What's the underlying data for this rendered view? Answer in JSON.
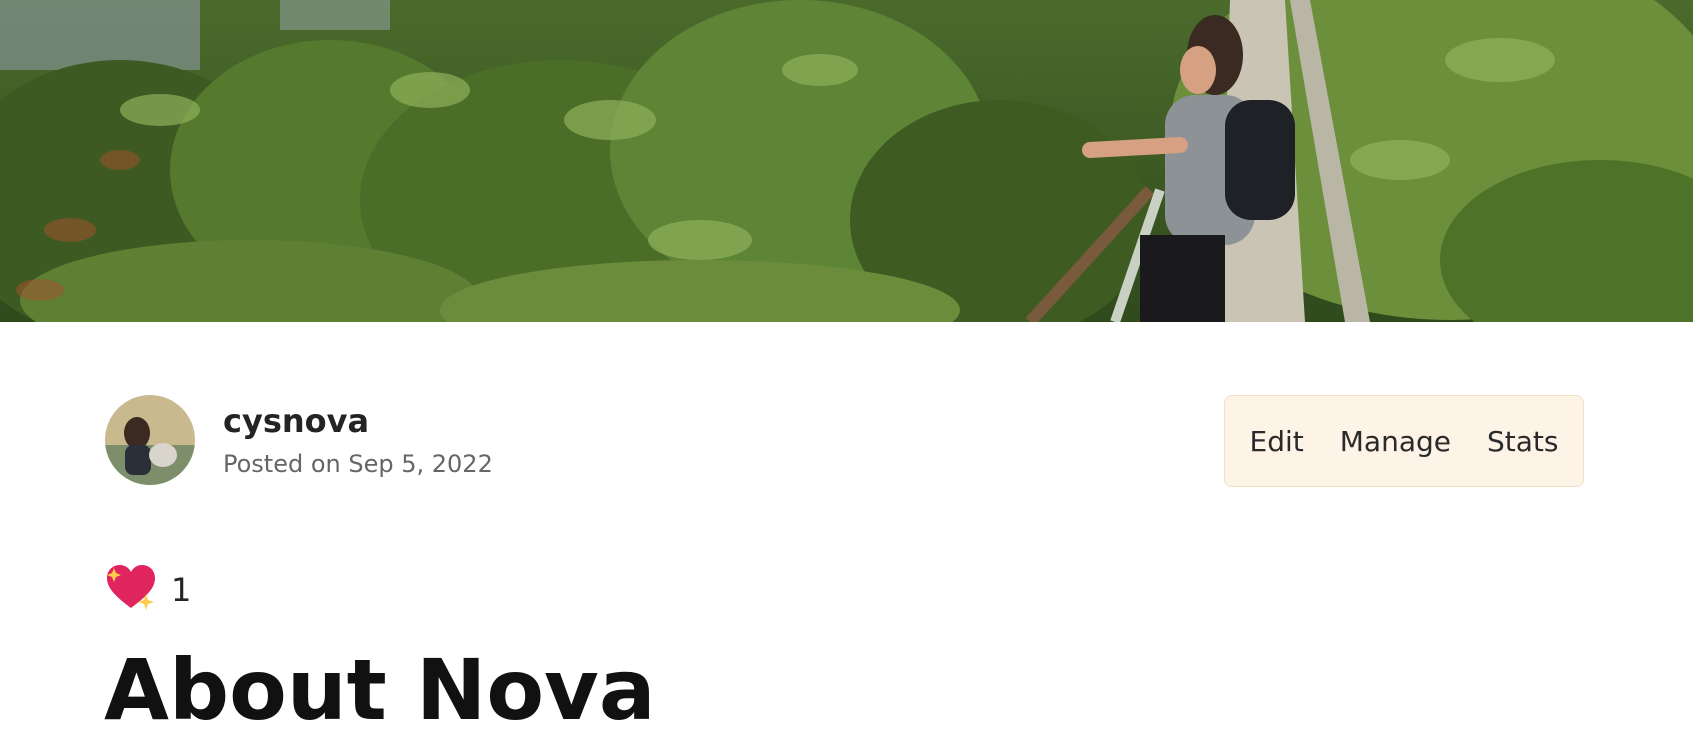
{
  "article": {
    "author": "cysnova",
    "posted": "Posted on Sep 5, 2022",
    "title": "About Nova"
  },
  "actions": {
    "edit": "Edit",
    "manage": "Manage",
    "stats": "Stats"
  },
  "reactions": {
    "icon": "sparkling-heart-icon",
    "count": "1"
  },
  "colors": {
    "actions_bg": "#fdf3e6",
    "actions_border": "#f4e0c4",
    "title": "#111111",
    "muted": "#666666"
  }
}
